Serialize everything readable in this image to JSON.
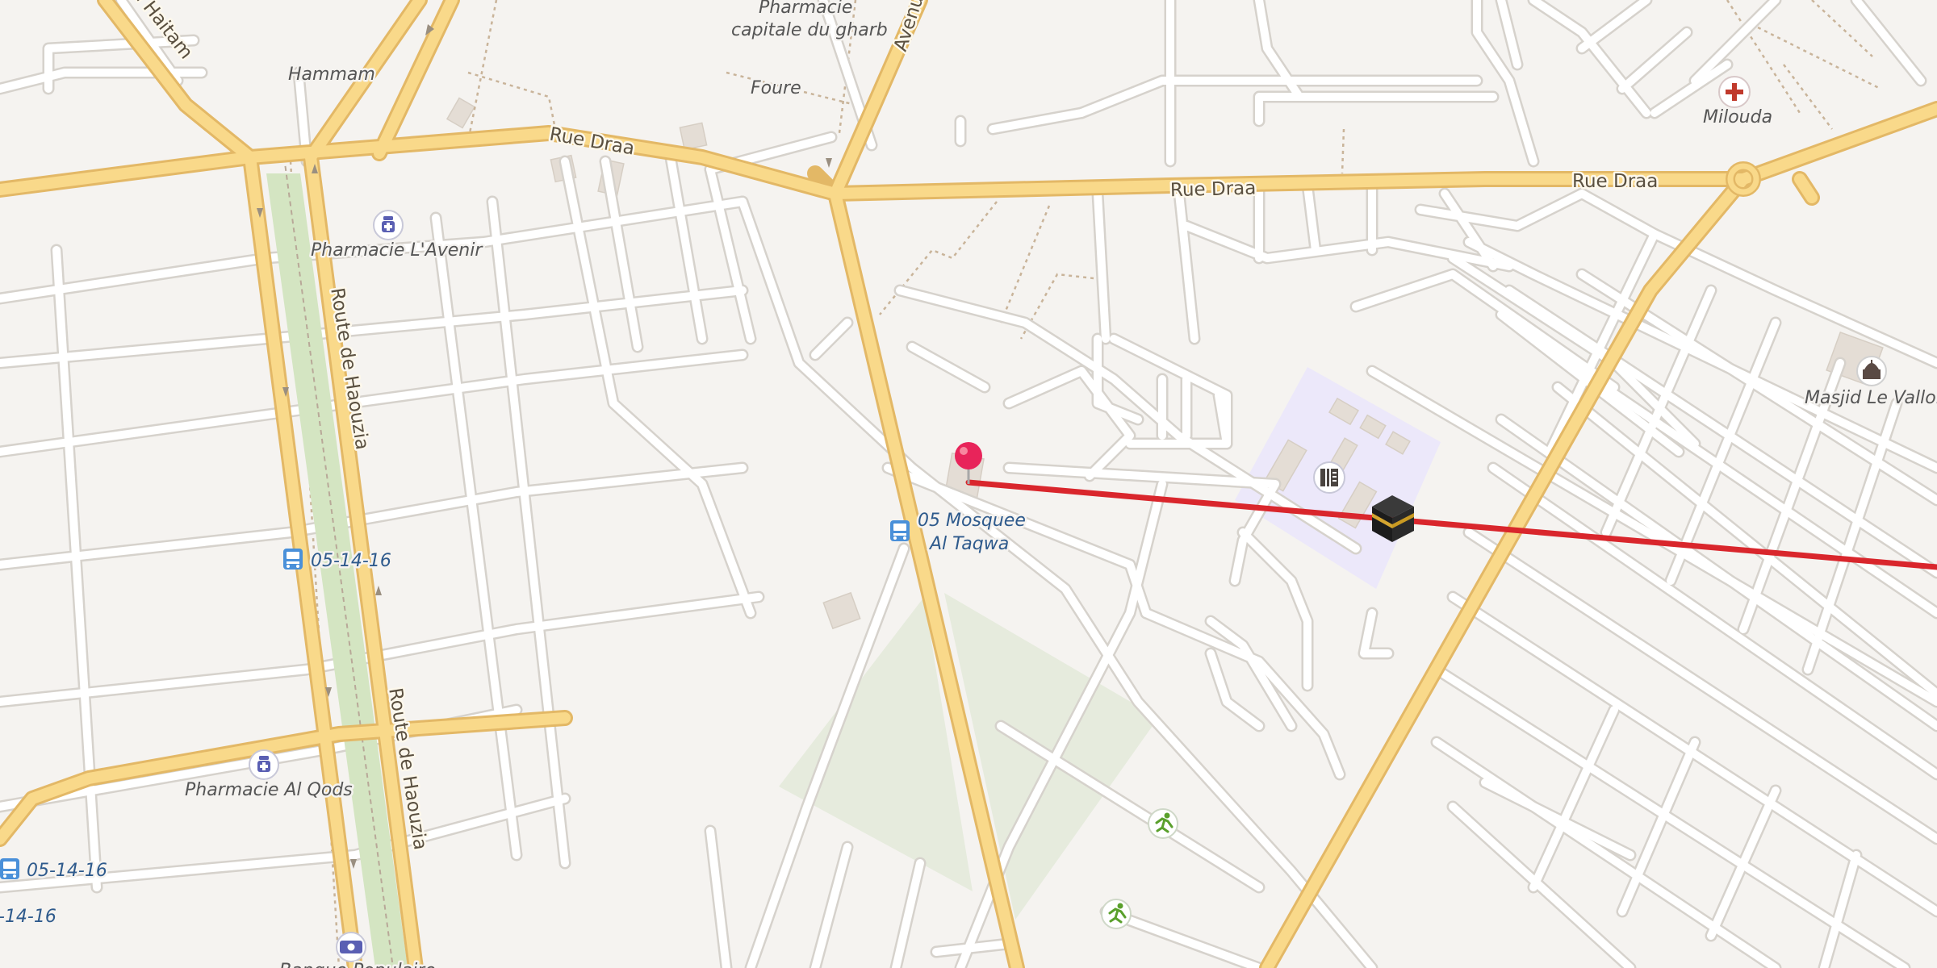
{
  "map": {
    "road_labels": {
      "rue_draa_west": "Rue Draa",
      "rue_draa_center": "Rue Draa",
      "rue_draa_east": "Rue Draa",
      "route_haouzia_north": "Route de Haouzia",
      "route_haouzia_south": "Route de Haouzia",
      "avenue_fragment": "Avenu",
      "haitam_fragment": "ai Haitam"
    },
    "pois": {
      "hammam": "Hammam",
      "pharmacie_gharb_line1": "Pharmacie",
      "pharmacie_gharb_line2": "capitale du gharb",
      "foure": "Foure",
      "milouda": "Milouda",
      "pharmacie_avenir": "Pharmacie L'Avenir",
      "masjid_vallon": "Masjid Le Vallon",
      "pharmacie_al_qods": "Pharmacie Al Qods",
      "bus_stop_1": "05-14-16",
      "bus_stop_2": "05-14-16",
      "bus_stop_3": "-14-16",
      "bus_mosque_line1": "05 Mosquee",
      "bus_mosque_line2": "Al Taqwa",
      "bottom_cut": "Banque Populaire"
    },
    "icons": {
      "pin": "map-pin-icon",
      "kaaba": "kaaba-icon",
      "school": "school-icon",
      "bus": "bus-stop-icon",
      "pharmacy": "pharmacy-icon",
      "hospital": "hospital-icon",
      "mosque": "mosque-icon",
      "sports": "sports-icon",
      "bank": "bank-icon"
    },
    "colors": {
      "background": "#f5f3f0",
      "major_road": "#f9d98a",
      "major_road_casing": "#e3b866",
      "minor_road": "#ffffff",
      "minor_road_casing": "#d6d2cc",
      "park": "#e6ebdd",
      "median_green": "#d4e5c2",
      "school_area": "#ece8fa",
      "qibla_line": "#d9262c",
      "pin": "#e8245a",
      "bus_icon": "#4a90d9",
      "pharmacy_icon": "#5a5fb3",
      "hospital_icon": "#c0392b",
      "sports_icon": "#5aa02c"
    }
  }
}
